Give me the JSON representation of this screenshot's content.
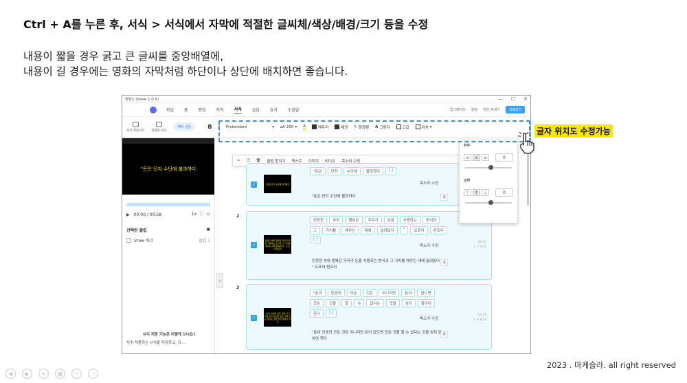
{
  "slide": {
    "heading": "Ctrl + A를 누른 후, 서식 > 서식에서 자막에 적절한 글씨체/색상/배경/크기 등을 수정",
    "body_line1": "내용이 짧을 경우 굵고 큰 글씨를 중앙배열에,",
    "body_line2": "내용이 길 경우에는 영화의 자막처럼 하단이나 상단에 배치하면 좋습니다.",
    "callout": "글자 위치도 수정가능",
    "footer": "2023 . 마케슬라. all right reserved"
  },
  "app": {
    "title": "영상1 (Vrew 1.0.5)",
    "window_controls": [
      "—",
      "☐",
      "✕"
    ],
    "menu": [
      "파일",
      "홈",
      "편집",
      "자막",
      "서식",
      "삽입",
      "효과",
      "도움말"
    ],
    "active_menu": "서식",
    "menu_right": [
      "업그레이드",
      "알림",
      "이전 버내기",
      "내보내기"
    ],
    "ribbon_small": [
      "서식 적용하기",
      "적정된 서식"
    ],
    "ribbon_pill": "예비 공동",
    "font_name": "Pretendard",
    "font_size": "200",
    "tools": [
      "테두리",
      "배경",
      "형광펜",
      "그림자",
      "고급",
      "위치"
    ],
    "left": {
      "preview_text": "\"돈은 단지 수단에 불과하다",
      "time": "00:00 / 00:58",
      "speed": "1x",
      "selected_label": "선택된 클립",
      "selected_item": "Vrew 마크",
      "selected_count": "클립 1",
      "hint_title": "서식 저장 기능은 어떻게 쓰나요?",
      "hint_body": "자주 적용하는 서식을 저장하고, 지..."
    },
    "floatbar": [
      "클립 합치기",
      "텍스트",
      "이미지",
      "비디오",
      "목소리 수정"
    ],
    "popover": {
      "h_label": "좌우",
      "h_value": "0",
      "v_label": "상하",
      "v_value": "0"
    }
  },
  "clips": [
    {
      "num": "1",
      "thumb": "\"돈은 단지 수단에 불과하다",
      "words": [
        "\"돈은",
        "단지",
        "수단에",
        "불과하다",
        "[.]"
      ],
      "caption": "\"돈은 단지 수단에 불과하다",
      "voice": "목소리 수정",
      "meta1": "",
      "meta2": ""
    },
    {
      "num": "2",
      "thumb": "진정한 부와 행복은 우리가 돈을 사용하는 방식과 그 가치를 채우는 데에 달려있다 \" 오프라 윈프리",
      "words": [
        "진정한",
        "부와",
        "행복은",
        "우리가",
        "돈을",
        "사용하는",
        "방식과",
        "그",
        "가치를",
        "채우는",
        "데에",
        "달려있다",
        "\"",
        "오프라",
        "윈프리",
        "[.]"
      ],
      "caption": "진정한 부와 행복은 우리가 돈을 사용하는 방식과 그 가치를 채우는 데에 달려있다 \" 오프라 윈프리",
      "voice": "목소리 수정",
      "meta1": "00:03",
      "meta2": "+ 7.37초"
    },
    {
      "num": "3",
      "thumb": "\"돈이 인생의 모든 것은 아니지만 돈이 없으면 모든 것을 할 수 없다는 것을 잊지 말아야 한다",
      "words": [
        "\"돈이",
        "인생의",
        "모든",
        "것은",
        "아니지만",
        "돈이",
        "없으면",
        "모든",
        "것을",
        "할",
        "수",
        "없다는",
        "것을",
        "잊지",
        "말아야",
        "한다",
        "[.]"
      ],
      "caption": "\"돈이 인생의 모든 것은 아니지만 돈이 없으면 모든 것을 할 수 없다는 것을 잊지 말아야 한다",
      "voice": "목소리 수정",
      "meta1": "00:10",
      "meta2": "+ 8.82초"
    }
  ],
  "colors": {
    "accent": "#3a8fe0",
    "callout_bg": "#ffe600",
    "card_bg": "#eef9fd"
  }
}
